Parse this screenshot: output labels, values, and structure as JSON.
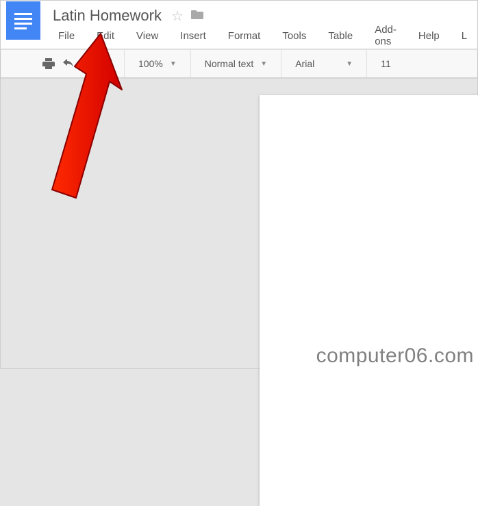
{
  "doc": {
    "title": "Latin Homework"
  },
  "menubar": {
    "items": [
      {
        "label": "File"
      },
      {
        "label": "Edit"
      },
      {
        "label": "View"
      },
      {
        "label": "Insert"
      },
      {
        "label": "Format"
      },
      {
        "label": "Tools"
      },
      {
        "label": "Table"
      },
      {
        "label": "Add-ons"
      },
      {
        "label": "Help"
      },
      {
        "label": "L"
      }
    ]
  },
  "toolbar": {
    "zoom": "100%",
    "style": "Normal text",
    "font": "Arial",
    "fontsize": "11"
  },
  "watermark": "computer06.com"
}
